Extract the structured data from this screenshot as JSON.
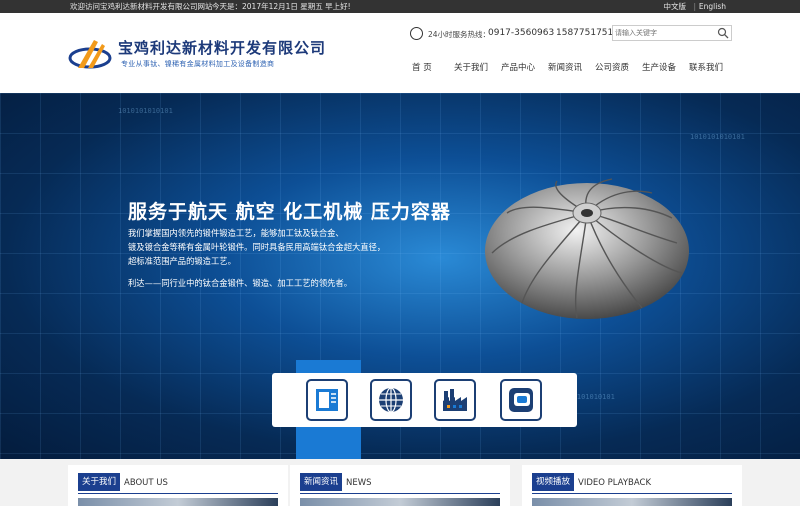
{
  "topbar": {
    "welcome": "欢迎访问宝鸡利达新材料开发有限公司网站",
    "date": "今天是：2017年12月1日  星期五  早上好!",
    "lang_cn": "中文版",
    "separator": "|",
    "lang_en": "English"
  },
  "header": {
    "company_name": "宝鸡利达新材料开发有限公司",
    "slogan": "专业从事钛、镍稀有金属材料加工及设备制造商",
    "hotline_label": "24小时服务热线：",
    "hotline_phone": "0917-3560963",
    "hotline_mobile": "15877517511",
    "search_placeholder": "请输入关键字"
  },
  "nav": {
    "items": [
      "首 页",
      "关于我们",
      "产品中心",
      "新闻资讯",
      "公司资质",
      "生产设备",
      "联系我们"
    ]
  },
  "banner": {
    "headline": "服务于航天  航空  化工机械  压力容器",
    "desc_line1": "我们掌握国内领先的锻件锻造工艺，能够加工钛及钛合金、",
    "desc_line2": "镀及镀合金等稀有金属叶轮锻件。同时具备民用高端钛合金超大直径，",
    "desc_line3": "超标准范围产品的锻造工艺。",
    "desc_line4": "利达——同行业中的钛合金锻件、锻造、加工工艺的领先者。",
    "binary": "1010101010101"
  },
  "quick_icons": [
    "document-icon",
    "globe-icon",
    "factory-icon",
    "chat-icon"
  ],
  "sections": [
    {
      "label": "关于我们",
      "en": "ABOUT US"
    },
    {
      "label": "新闻资讯",
      "en": "NEWS"
    },
    {
      "label": "视频播放",
      "en": "VIDEO PLAYBACK"
    }
  ],
  "colors": {
    "brand_blue": "#1b3f8f",
    "accent_blue": "#1a7ad4",
    "topbar_bg": "#333333"
  }
}
